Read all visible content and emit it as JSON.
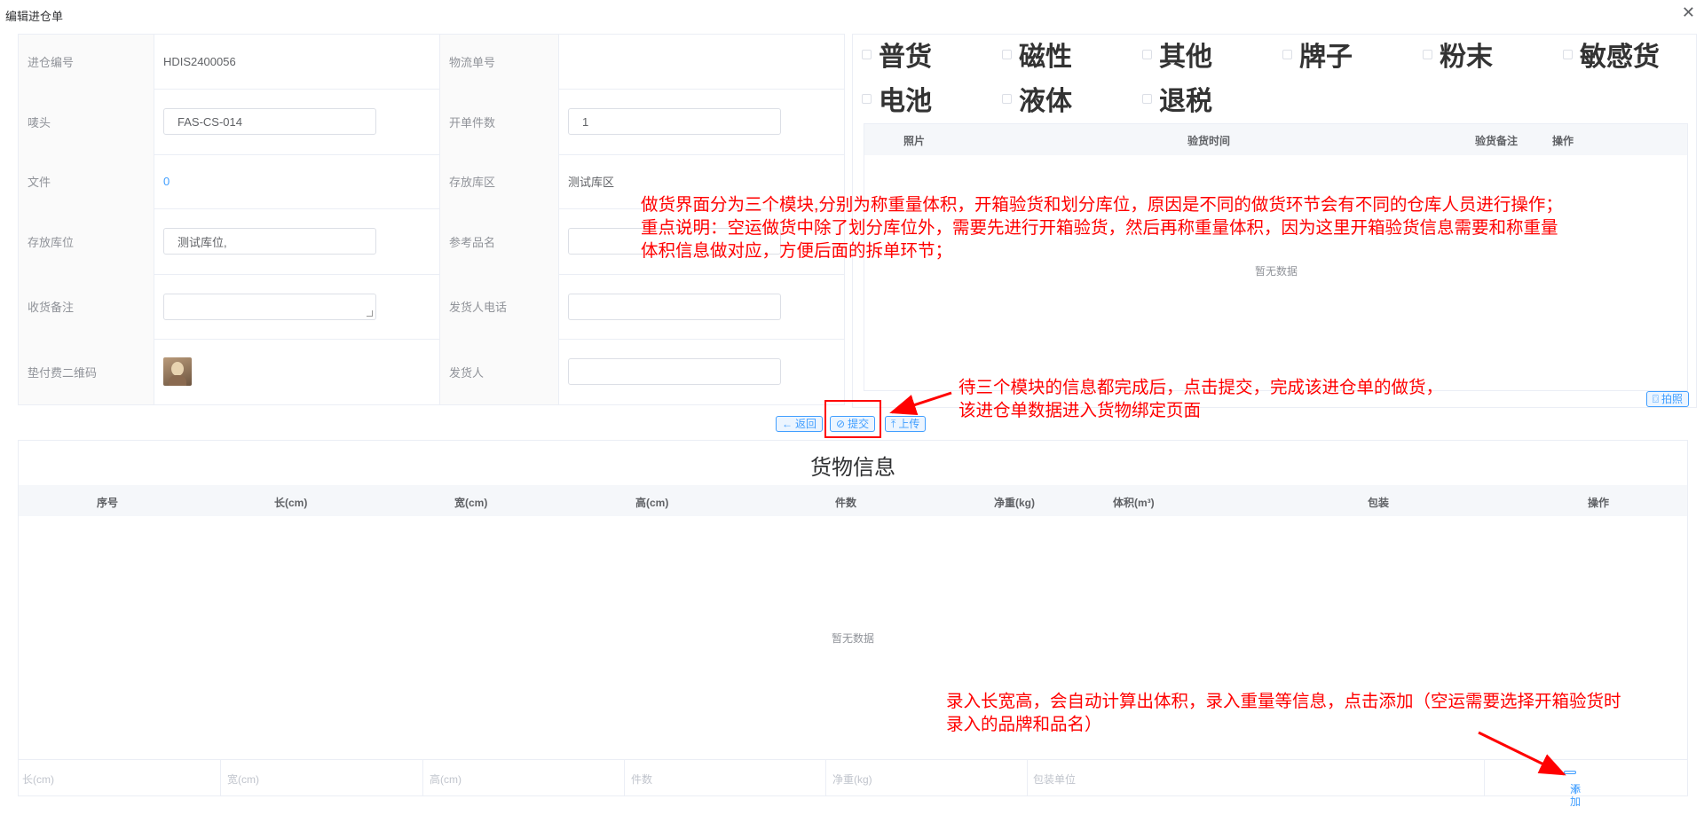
{
  "dialog": {
    "title": "编辑进仓单",
    "close_icon": "close-icon"
  },
  "form": {
    "rows": [
      {
        "label1": "进仓编号",
        "value1": "HDIS2400056",
        "label2": "物流单号",
        "value2": ""
      },
      {
        "label1": "唛头",
        "value1": "FAS-CS-014",
        "label2": "开单件数",
        "value2": "1"
      },
      {
        "label1": "文件",
        "value1": "0",
        "label2": "存放库区",
        "value2": "测试库区"
      },
      {
        "label1": "存放库位",
        "value1": "测试库位,",
        "label2": "参考品名",
        "value2": ""
      },
      {
        "label1": "收货备注",
        "value1": "",
        "label2": "发货人电话",
        "value2": ""
      },
      {
        "label1": "垫付费二维码",
        "value1": "",
        "label2": "发货人",
        "value2": ""
      }
    ]
  },
  "cargo_types": {
    "row1": [
      "普货",
      "磁性",
      "其他",
      "牌子",
      "粉末",
      "敏感货"
    ],
    "row2": [
      "电池",
      "液体",
      "退税"
    ]
  },
  "photo_table": {
    "headers": [
      "照片",
      "验货时间",
      "验货备注",
      "操作"
    ],
    "empty_text": "暂无数据",
    "photo_button": "拍照"
  },
  "actions": {
    "back": "返回",
    "submit": "提交",
    "upload": "上传"
  },
  "goods": {
    "title": "货物信息",
    "headers": [
      "序号",
      "长(cm)",
      "宽(cm)",
      "高(cm)",
      "件数",
      "净重(kg)",
      "体积(m³)",
      "包装",
      "操作"
    ],
    "empty_text": "暂无数据",
    "inputs": [
      "长(cm)",
      "宽(cm)",
      "高(cm)",
      "件数",
      "净重(kg)",
      "包装单位"
    ],
    "add_button": "添加"
  },
  "annotations": {
    "note1": [
      "做货界面分为三个模块,分别为称重量体积，开箱验货和划分库位，原因是不同的做货环节会有不同的仓库人员进行操作；",
      "重点说明：空运做货中除了划分库位外，需要先进行开箱验货，然后再称重量体积，因为这里开箱验货信息需要和称重量",
      "体积信息做对应，方便后面的拆单环节；"
    ],
    "note2": [
      "待三个模块的信息都完成后，点击提交，完成该进仓单的做货，",
      "该进仓单数据进入货物绑定页面"
    ],
    "note3": [
      "录入长宽高，会自动计算出体积，录入重量等信息，点击添加（空运需要选择开箱验货时",
      "录入的品牌和品名）"
    ]
  },
  "colors": {
    "primary": "#409eff",
    "annotation": "#ff0000"
  }
}
